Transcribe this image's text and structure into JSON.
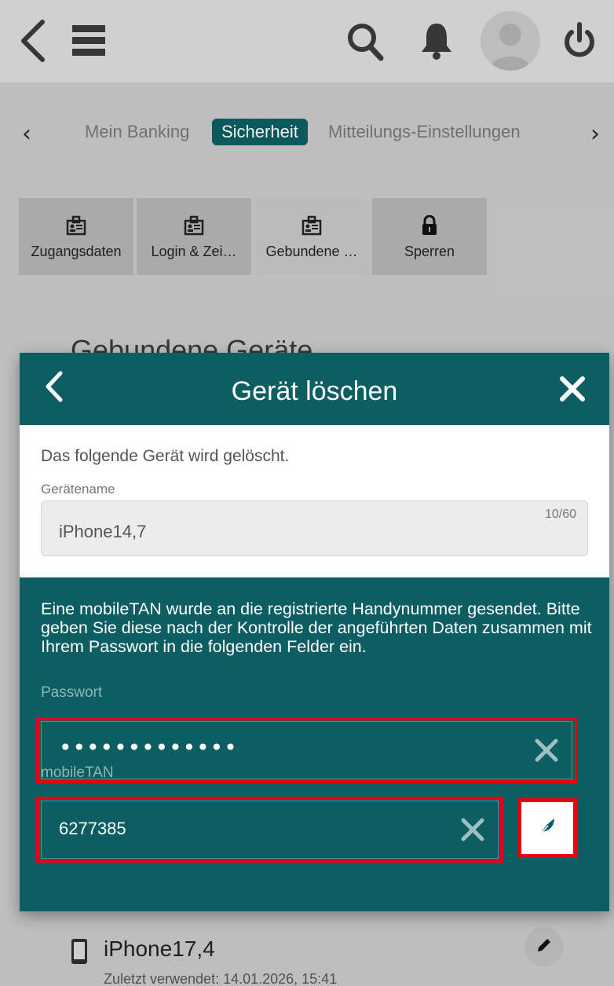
{
  "colors": {
    "teal": "#0c5e62",
    "highlight_red": "#e60012",
    "muted_teal_text": "#8fb6b8"
  },
  "topbar": {
    "icons": [
      "chevron-left-icon",
      "menu-icon",
      "search-icon",
      "bell-icon",
      "avatar",
      "power-icon"
    ]
  },
  "subnav": {
    "items": [
      "Mein Banking",
      "Sicherheit",
      "Mitteilungs-Einstellungen"
    ],
    "active": "Sicherheit"
  },
  "tabs": [
    {
      "label": "Zugangsdaten",
      "icon": "id-card-icon"
    },
    {
      "label": "Login & Zei…",
      "icon": "id-card-icon"
    },
    {
      "label": "Gebundene …",
      "icon": "id-card-icon"
    },
    {
      "label": "Sperren",
      "icon": "lock-icon"
    }
  ],
  "panel": {
    "heading": "Gebundene Geräte"
  },
  "modal": {
    "title": "Gerät löschen",
    "intro": "Das folgende Gerät wird gelöscht.",
    "device_name_label": "Gerätename",
    "device_name_value": "iPhone14,7",
    "device_name_counter": "10/60",
    "instructions": "Eine mobileTAN wurde an die registrierte Handynummer gesendet. Bitte geben Sie diese nach der Kontrolle der angeführten Daten zusammen mit Ihrem Passwort in die folgenden Felder ein.",
    "password_label": "Passwort",
    "password_value": "•••••••••••••",
    "tan_label": "mobileTAN",
    "tan_value": "6277385"
  },
  "device_list": {
    "items": [
      {
        "name": "iPhone17,4",
        "sub": "Zuletzt verwendet: 14.01.2026, 15:41"
      }
    ]
  }
}
